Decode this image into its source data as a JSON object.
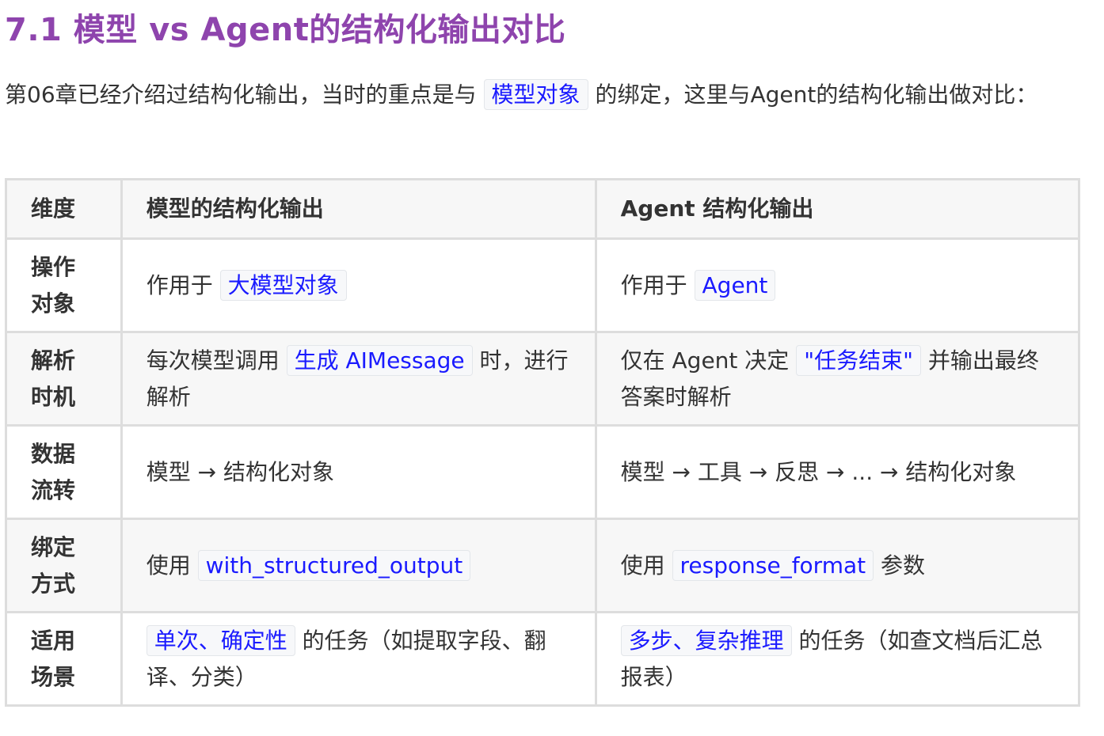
{
  "heading": "7.1 模型 vs Agent的结构化输出对比",
  "intro": {
    "before": "第06章已经介绍过结构化输出，当时的重点是与 ",
    "code": "模型对象",
    "after": " 的绑定，这里与Agent的结构化输出做对比："
  },
  "table": {
    "headers": [
      "维度",
      "模型的结构化输出",
      "Agent 结构化输出"
    ],
    "rows": [
      {
        "dim": "操作对象",
        "model": {
          "pre": "作用于 ",
          "code": "大模型对象",
          "post": ""
        },
        "agent": {
          "pre": "作用于 ",
          "code": "Agent",
          "post": ""
        }
      },
      {
        "dim": "解析时机",
        "model": {
          "pre": "每次模型调用 ",
          "code": "生成 AIMessage",
          "post": " 时，进行解析"
        },
        "agent": {
          "pre": "仅在 Agent 决定 ",
          "code": "\"任务结束\"",
          "post": " 并输出最终答案时解析"
        }
      },
      {
        "dim": "数据流转",
        "model": {
          "pre": "模型 → 结构化对象",
          "code": "",
          "post": ""
        },
        "agent": {
          "pre": "模型 → 工具 → 反思 → ... → 结构化对象",
          "code": "",
          "post": ""
        }
      },
      {
        "dim": "绑定方式",
        "model": {
          "pre": "使用 ",
          "code": "with_structured_output",
          "post": ""
        },
        "agent": {
          "pre": "使用 ",
          "code": "response_format",
          "post": " 参数"
        }
      },
      {
        "dim": "适用场景",
        "model": {
          "pre": "",
          "code": "单次、确定性",
          "post": " 的任务（如提取字段、翻译、分类）"
        },
        "agent": {
          "pre": "",
          "code": "多步、复杂推理",
          "post": " 的任务（如查文档后汇总报表）"
        }
      }
    ]
  },
  "colors": {
    "heading": "#8e44ad",
    "code_text": "#1a1aff",
    "code_bg": "#f7f8fa",
    "border": "#dddddd",
    "alt_row_bg": "#f7f7f7"
  }
}
